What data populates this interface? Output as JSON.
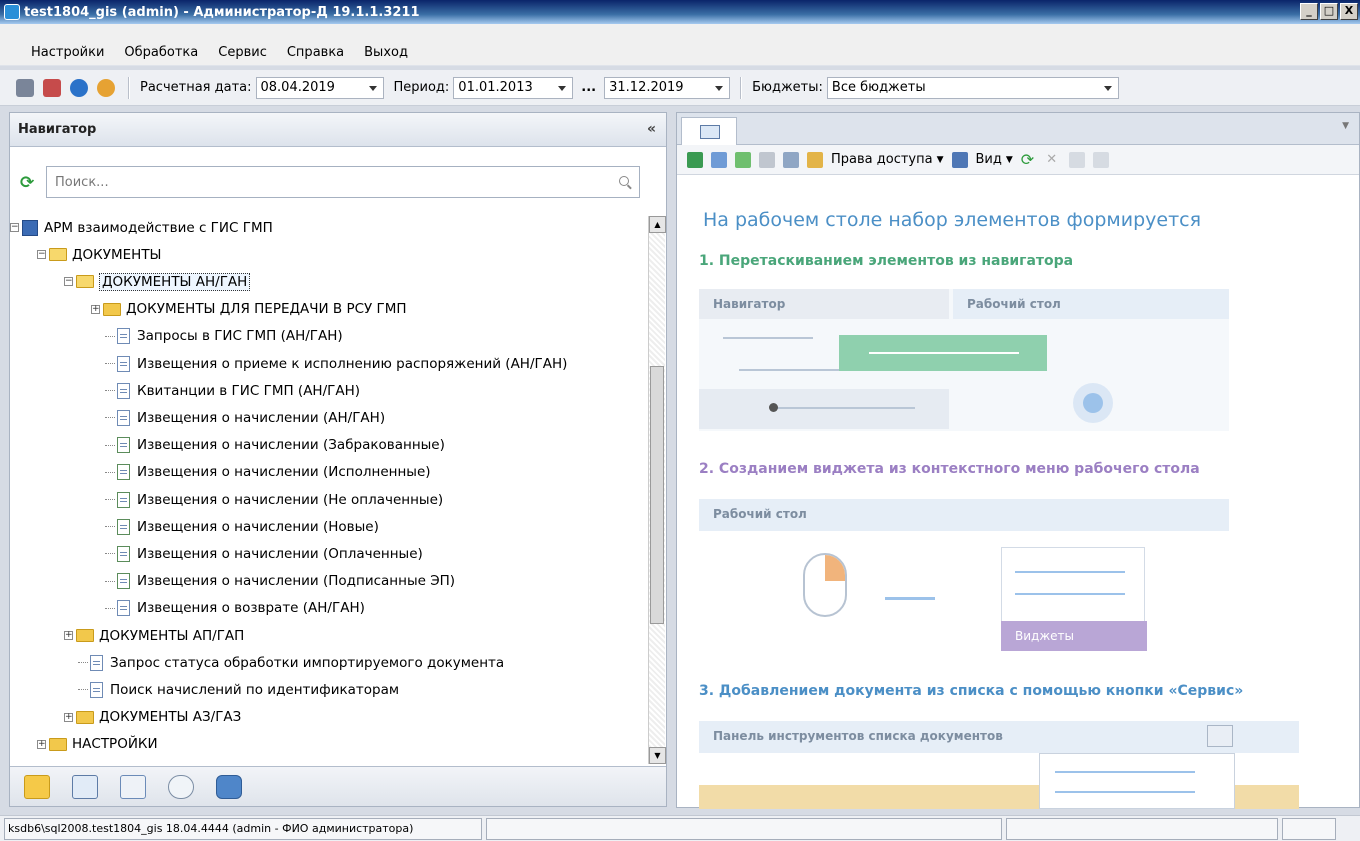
{
  "window": {
    "title": "test1804_gis (admin) - Администратор-Д 19.1.1.3211",
    "btn_min": "_",
    "btn_max": "□",
    "btn_close": "X"
  },
  "menu": [
    "Настройки",
    "Обработка",
    "Сервис",
    "Справка",
    "Выход"
  ],
  "toolbar": {
    "calc_date_label": "Расчетная дата:",
    "calc_date_value": "08.04.2019",
    "period_label": "Период:",
    "period_from": "01.01.2013",
    "period_ellipsis": "...",
    "period_to": "31.12.2019",
    "budgets_label": "Бюджеты:",
    "budgets_value": "Все бюджеты"
  },
  "navigator": {
    "title": "Навигатор",
    "collapse": "«",
    "search_placeholder": "Поиск...",
    "tree": [
      {
        "label": "АРМ взаимодействие с ГИС ГМП",
        "level": 0,
        "icon": "book-icon",
        "exp": "−"
      },
      {
        "label": "ДОКУМЕНТЫ",
        "level": 1,
        "icon": "folder-open-icon",
        "exp": "−"
      },
      {
        "label": "ДОКУМЕНТЫ АН/ГАН",
        "level": 2,
        "icon": "folder-open-icon",
        "exp": "−",
        "selected": true
      },
      {
        "label": "ДОКУМЕНТЫ ДЛЯ ПЕРЕДАЧИ В РСУ ГМП",
        "level": 3,
        "icon": "folder-icon",
        "exp": "+"
      },
      {
        "label": "Запросы в ГИС ГМП (АН/ГАН)",
        "level": 3,
        "icon": "document-icon"
      },
      {
        "label": "Извещения о приеме к исполнению распоряжений (АН/ГАН)",
        "level": 3,
        "icon": "document-icon"
      },
      {
        "label": "Квитанции в ГИС ГМП (АН/ГАН)",
        "level": 3,
        "icon": "document-icon"
      },
      {
        "label": "Извещения о начислении (АН/ГАН)",
        "level": 3,
        "icon": "document-icon"
      },
      {
        "label": "Извещения о начислении (Забракованные)",
        "level": 3,
        "icon": "document-filter-icon"
      },
      {
        "label": "Извещения о начислении (Исполненные)",
        "level": 3,
        "icon": "document-filter-icon"
      },
      {
        "label": "Извещения о начислении (Не оплаченные)",
        "level": 3,
        "icon": "document-filter-icon"
      },
      {
        "label": "Извещения о начислении (Новые)",
        "level": 3,
        "icon": "document-filter-icon"
      },
      {
        "label": "Извещения о начислении (Оплаченные)",
        "level": 3,
        "icon": "document-filter-icon"
      },
      {
        "label": "Извещения о начислении (Подписанные ЭП)",
        "level": 3,
        "icon": "document-filter-icon"
      },
      {
        "label": "Извещения о возврате (АН/ГАН)",
        "level": 3,
        "icon": "document-icon"
      },
      {
        "label": "ДОКУМЕНТЫ АП/ГАП",
        "level": 2,
        "icon": "folder-icon",
        "exp": "+"
      },
      {
        "label": "Запрос статуса обработки импортируемого документа",
        "level": 2,
        "icon": "document-icon"
      },
      {
        "label": "Поиск начислений по идентификаторам",
        "level": 2,
        "icon": "document-icon"
      },
      {
        "label": "ДОКУМЕНТЫ АЗ/ГАЗ",
        "level": 2,
        "icon": "folder-icon",
        "exp": "+"
      },
      {
        "label": "НАСТРОЙКИ",
        "level": 1,
        "icon": "folder-icon",
        "exp": "+"
      }
    ]
  },
  "workspace": {
    "toolbar_access": "Права доступа",
    "toolbar_view": "Вид",
    "heading": "На рабочем столе набор элементов формируется",
    "step1": "1. Перетаскиванием элементов из навигатора",
    "step1_nav": "Навигатор",
    "step1_desk": "Рабочий стол",
    "step2": "2. Созданием виджета из контекстного меню рабочего стола",
    "step2_desk": "Рабочий стол",
    "step2_menu": "Виджеты",
    "step3": "3. Добавлением документа из списка с помощью кнопки «Сервис»",
    "step3_panel": "Панель инструментов списка документов"
  },
  "status": {
    "connection": "ksdb6\\sql2008.test1804_gis 18.04.4444 (admin - ФИО администратора)"
  },
  "colors": {
    "accent": "#4b8fc6",
    "step2": "#9b7fc3",
    "step3": "#4b8fc6",
    "step1": "#4aa67a"
  }
}
